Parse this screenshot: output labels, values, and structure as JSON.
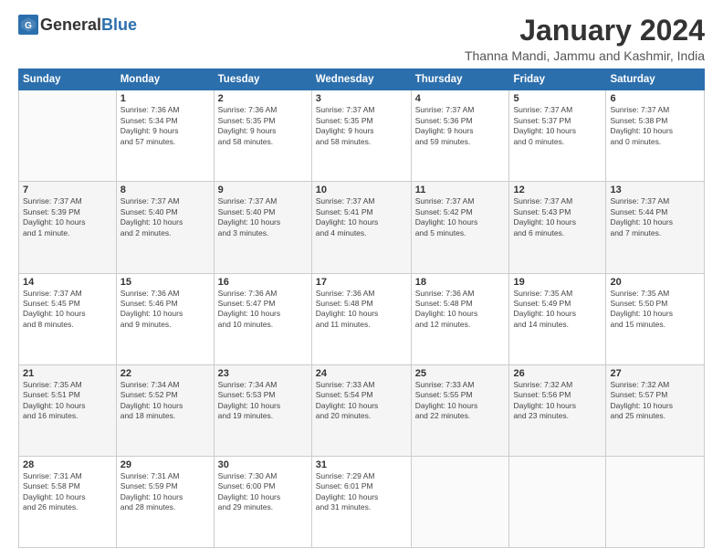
{
  "logo": {
    "general": "General",
    "blue": "Blue"
  },
  "header": {
    "month": "January 2024",
    "location": "Thanna Mandi, Jammu and Kashmir, India"
  },
  "days_of_week": [
    "Sunday",
    "Monday",
    "Tuesday",
    "Wednesday",
    "Thursday",
    "Friday",
    "Saturday"
  ],
  "weeks": [
    [
      {
        "day": "",
        "info": ""
      },
      {
        "day": "1",
        "info": "Sunrise: 7:36 AM\nSunset: 5:34 PM\nDaylight: 9 hours\nand 57 minutes."
      },
      {
        "day": "2",
        "info": "Sunrise: 7:36 AM\nSunset: 5:35 PM\nDaylight: 9 hours\nand 58 minutes."
      },
      {
        "day": "3",
        "info": "Sunrise: 7:37 AM\nSunset: 5:35 PM\nDaylight: 9 hours\nand 58 minutes."
      },
      {
        "day": "4",
        "info": "Sunrise: 7:37 AM\nSunset: 5:36 PM\nDaylight: 9 hours\nand 59 minutes."
      },
      {
        "day": "5",
        "info": "Sunrise: 7:37 AM\nSunset: 5:37 PM\nDaylight: 10 hours\nand 0 minutes."
      },
      {
        "day": "6",
        "info": "Sunrise: 7:37 AM\nSunset: 5:38 PM\nDaylight: 10 hours\nand 0 minutes."
      }
    ],
    [
      {
        "day": "7",
        "info": "Sunrise: 7:37 AM\nSunset: 5:39 PM\nDaylight: 10 hours\nand 1 minute."
      },
      {
        "day": "8",
        "info": "Sunrise: 7:37 AM\nSunset: 5:40 PM\nDaylight: 10 hours\nand 2 minutes."
      },
      {
        "day": "9",
        "info": "Sunrise: 7:37 AM\nSunset: 5:40 PM\nDaylight: 10 hours\nand 3 minutes."
      },
      {
        "day": "10",
        "info": "Sunrise: 7:37 AM\nSunset: 5:41 PM\nDaylight: 10 hours\nand 4 minutes."
      },
      {
        "day": "11",
        "info": "Sunrise: 7:37 AM\nSunset: 5:42 PM\nDaylight: 10 hours\nand 5 minutes."
      },
      {
        "day": "12",
        "info": "Sunrise: 7:37 AM\nSunset: 5:43 PM\nDaylight: 10 hours\nand 6 minutes."
      },
      {
        "day": "13",
        "info": "Sunrise: 7:37 AM\nSunset: 5:44 PM\nDaylight: 10 hours\nand 7 minutes."
      }
    ],
    [
      {
        "day": "14",
        "info": "Sunrise: 7:37 AM\nSunset: 5:45 PM\nDaylight: 10 hours\nand 8 minutes."
      },
      {
        "day": "15",
        "info": "Sunrise: 7:36 AM\nSunset: 5:46 PM\nDaylight: 10 hours\nand 9 minutes."
      },
      {
        "day": "16",
        "info": "Sunrise: 7:36 AM\nSunset: 5:47 PM\nDaylight: 10 hours\nand 10 minutes."
      },
      {
        "day": "17",
        "info": "Sunrise: 7:36 AM\nSunset: 5:48 PM\nDaylight: 10 hours\nand 11 minutes."
      },
      {
        "day": "18",
        "info": "Sunrise: 7:36 AM\nSunset: 5:48 PM\nDaylight: 10 hours\nand 12 minutes."
      },
      {
        "day": "19",
        "info": "Sunrise: 7:35 AM\nSunset: 5:49 PM\nDaylight: 10 hours\nand 14 minutes."
      },
      {
        "day": "20",
        "info": "Sunrise: 7:35 AM\nSunset: 5:50 PM\nDaylight: 10 hours\nand 15 minutes."
      }
    ],
    [
      {
        "day": "21",
        "info": "Sunrise: 7:35 AM\nSunset: 5:51 PM\nDaylight: 10 hours\nand 16 minutes."
      },
      {
        "day": "22",
        "info": "Sunrise: 7:34 AM\nSunset: 5:52 PM\nDaylight: 10 hours\nand 18 minutes."
      },
      {
        "day": "23",
        "info": "Sunrise: 7:34 AM\nSunset: 5:53 PM\nDaylight: 10 hours\nand 19 minutes."
      },
      {
        "day": "24",
        "info": "Sunrise: 7:33 AM\nSunset: 5:54 PM\nDaylight: 10 hours\nand 20 minutes."
      },
      {
        "day": "25",
        "info": "Sunrise: 7:33 AM\nSunset: 5:55 PM\nDaylight: 10 hours\nand 22 minutes."
      },
      {
        "day": "26",
        "info": "Sunrise: 7:32 AM\nSunset: 5:56 PM\nDaylight: 10 hours\nand 23 minutes."
      },
      {
        "day": "27",
        "info": "Sunrise: 7:32 AM\nSunset: 5:57 PM\nDaylight: 10 hours\nand 25 minutes."
      }
    ],
    [
      {
        "day": "28",
        "info": "Sunrise: 7:31 AM\nSunset: 5:58 PM\nDaylight: 10 hours\nand 26 minutes."
      },
      {
        "day": "29",
        "info": "Sunrise: 7:31 AM\nSunset: 5:59 PM\nDaylight: 10 hours\nand 28 minutes."
      },
      {
        "day": "30",
        "info": "Sunrise: 7:30 AM\nSunset: 6:00 PM\nDaylight: 10 hours\nand 29 minutes."
      },
      {
        "day": "31",
        "info": "Sunrise: 7:29 AM\nSunset: 6:01 PM\nDaylight: 10 hours\nand 31 minutes."
      },
      {
        "day": "",
        "info": ""
      },
      {
        "day": "",
        "info": ""
      },
      {
        "day": "",
        "info": ""
      }
    ]
  ]
}
